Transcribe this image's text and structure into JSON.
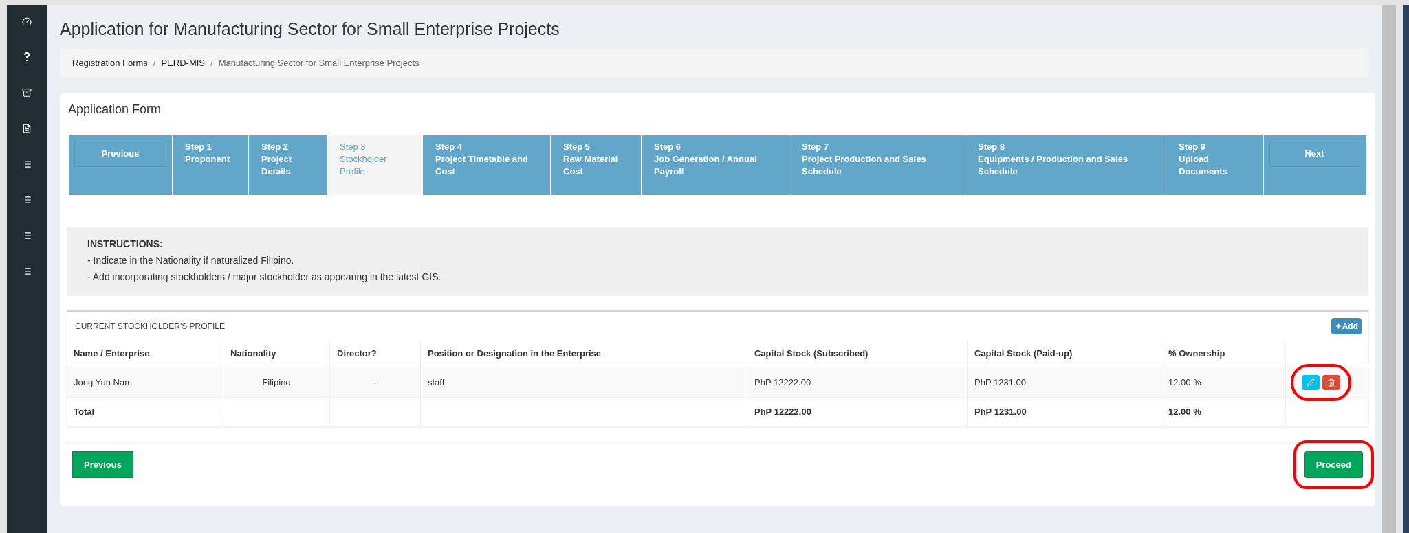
{
  "sidebar": {
    "items": [
      {
        "kind": "dashboard"
      },
      {
        "kind": "help"
      },
      {
        "kind": "archive"
      },
      {
        "kind": "file"
      },
      {
        "kind": "list"
      },
      {
        "kind": "list"
      },
      {
        "kind": "list"
      },
      {
        "kind": "list"
      }
    ]
  },
  "page_title": "Application for Manufacturing Sector for Small Enterprise Projects",
  "breadcrumb_separators": [
    "/",
    "/"
  ],
  "breadcrumb": [
    {
      "label": "Registration Forms",
      "current": false
    },
    {
      "label": "PERD-MIS",
      "current": false
    },
    {
      "label": "Manufacturing Sector for Small Enterprise Projects",
      "current": true
    }
  ],
  "card_title": "Application Form",
  "steps": [
    {
      "kind": "nav",
      "label": "Previous"
    },
    {
      "kind": "step",
      "number": "Step 1",
      "label": "Proponent",
      "selected": false
    },
    {
      "kind": "step",
      "number": "Step 2",
      "label": "Project Details",
      "selected": false
    },
    {
      "kind": "step",
      "number": "Step 3",
      "label": "Stockholder Profile",
      "selected": true
    },
    {
      "kind": "step",
      "number": "Step 4",
      "label": "Project Timetable and Cost",
      "selected": false
    },
    {
      "kind": "step",
      "number": "Step 5",
      "label": "Raw Material Cost",
      "selected": false
    },
    {
      "kind": "step",
      "number": "Step 6",
      "label": "Job Generation / Annual Payroll",
      "selected": false
    },
    {
      "kind": "step",
      "number": "Step 7",
      "label": "Project Production and Sales Schedule",
      "selected": false
    },
    {
      "kind": "step",
      "number": "Step 8",
      "label": "Equipments / Production and Sales Schedule",
      "selected": false
    },
    {
      "kind": "step",
      "number": "Step 9",
      "label": "Upload Documents",
      "selected": false
    },
    {
      "kind": "nav",
      "label": "Next"
    }
  ],
  "instructions": {
    "heading": "INSTRUCTIONS:",
    "lines": [
      "- Indicate in the Nationality if naturalized Filipino.",
      "- Add incorporating stockholders / major stockholder as appearing in the latest GIS."
    ]
  },
  "table": {
    "title": "CURRENT STOCKHOLDER'S PROFILE",
    "add_button": "Add",
    "columns": [
      "Name / Enterprise",
      "Nationality",
      "Director?",
      "Position or Designation in the Enterprise",
      "Capital Stock (Subscribed)",
      "Capital Stock (Paid-up)",
      "% Ownership"
    ],
    "rows": [
      {
        "kind": "entry",
        "cells": [
          "Jong Yun Nam",
          "Filipino",
          "--",
          "staff",
          "PhP 12222.00",
          "PhP 1231.00",
          "12.00 %"
        ],
        "highlighted": true
      },
      {
        "kind": "total",
        "cells": [
          "Total",
          "",
          "",
          "",
          "PhP 12222.00",
          "PhP 1231.00",
          "12.00 %"
        ],
        "highlighted": false
      }
    ]
  },
  "footer": {
    "previous": {
      "label": "Previous",
      "highlighted": false
    },
    "proceed": {
      "label": "Proceed",
      "highlighted": true
    }
  }
}
